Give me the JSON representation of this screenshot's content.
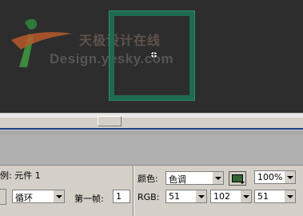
{
  "watermark": {
    "text_cn": "天极设计在线",
    "text_en": "Design.yesky.com"
  },
  "properties": {
    "instance_label": "例: 元件 1",
    "loop_select": "循环",
    "first_frame_label": "第一帧:",
    "first_frame_value": "1",
    "color_label": "颜色:",
    "color_mode": "色调",
    "tint_color": "#336633",
    "percent_value": "100%",
    "rgb_label": "RGB:",
    "r_value": "51",
    "g_value": "102",
    "b_value": "51"
  }
}
